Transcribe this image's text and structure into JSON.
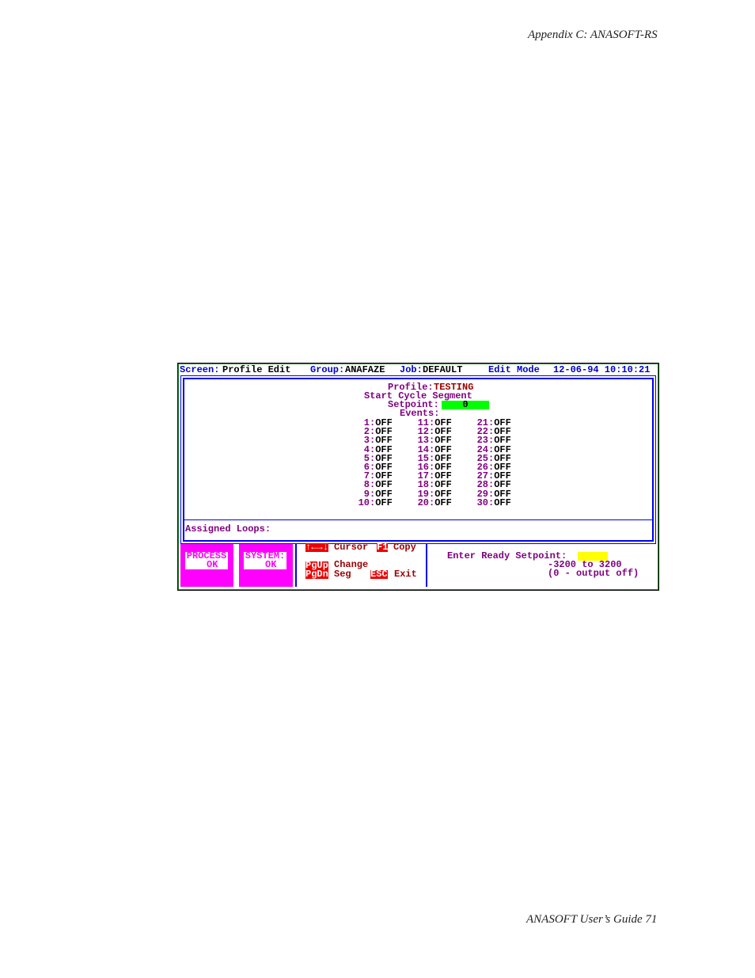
{
  "header": "Appendix C: ANASOFT-RS",
  "footer": "ANASOFT User’s Guide  71",
  "screen": {
    "top": {
      "screen_label": "Screen:",
      "screen_value": "Profile Edit",
      "group_label": "Group:",
      "group_value": "ANAFAZE",
      "job_label": "Job:",
      "job_value": "DEFAULT",
      "mode": "Edit Mode",
      "datetime": "12-06-94 10:10:21"
    },
    "profile_label": "Profile:",
    "profile_value": "TESTING",
    "start_cycle": "Start Cycle Segment",
    "setpoint_label": "Setpoint:",
    "setpoint_value": "0",
    "events_label": "Events:",
    "events": [
      {
        "n": "1",
        "v": "OFF"
      },
      {
        "n": "2",
        "v": "OFF"
      },
      {
        "n": "3",
        "v": "OFF"
      },
      {
        "n": "4",
        "v": "OFF"
      },
      {
        "n": "5",
        "v": "OFF"
      },
      {
        "n": "6",
        "v": "OFF"
      },
      {
        "n": "7",
        "v": "OFF"
      },
      {
        "n": "8",
        "v": "OFF"
      },
      {
        "n": "9",
        "v": "OFF"
      },
      {
        "n": "10",
        "v": "OFF"
      },
      {
        "n": "11",
        "v": "OFF"
      },
      {
        "n": "12",
        "v": "OFF"
      },
      {
        "n": "13",
        "v": "OFF"
      },
      {
        "n": "14",
        "v": "OFF"
      },
      {
        "n": "15",
        "v": "OFF"
      },
      {
        "n": "16",
        "v": "OFF"
      },
      {
        "n": "17",
        "v": "OFF"
      },
      {
        "n": "18",
        "v": "OFF"
      },
      {
        "n": "19",
        "v": "OFF"
      },
      {
        "n": "20",
        "v": "OFF"
      },
      {
        "n": "21",
        "v": "OFF"
      },
      {
        "n": "22",
        "v": "OFF"
      },
      {
        "n": "23",
        "v": "OFF"
      },
      {
        "n": "24",
        "v": "OFF"
      },
      {
        "n": "25",
        "v": "OFF"
      },
      {
        "n": "26",
        "v": "OFF"
      },
      {
        "n": "27",
        "v": "OFF"
      },
      {
        "n": "28",
        "v": "OFF"
      },
      {
        "n": "29",
        "v": "OFF"
      },
      {
        "n": "30",
        "v": "OFF"
      }
    ],
    "assigned_loops": "Assigned Loops:",
    "process": "PROCESS\n  OK",
    "system": "SYSTEM:\n  OK",
    "keys": {
      "arrows": "↑←→↓",
      "cursor": "Cursor",
      "f1": "F1",
      "copy": "Copy",
      "pgup": "PgUp",
      "change": "Change",
      "pgdn": "PgDn",
      "seg": "Seg",
      "esc": "ESC",
      "exit": "Exit"
    },
    "prompt": "Enter Ready Setpoint:",
    "range": "-3200 to 3200",
    "note": "(0 - output off)",
    "colors": {
      "magenta": "#ff00ff",
      "green": "#00ff00",
      "yellow": "#ffff00",
      "blue": "#0000cc",
      "purple": "#800080",
      "red": "#ee0000"
    }
  }
}
